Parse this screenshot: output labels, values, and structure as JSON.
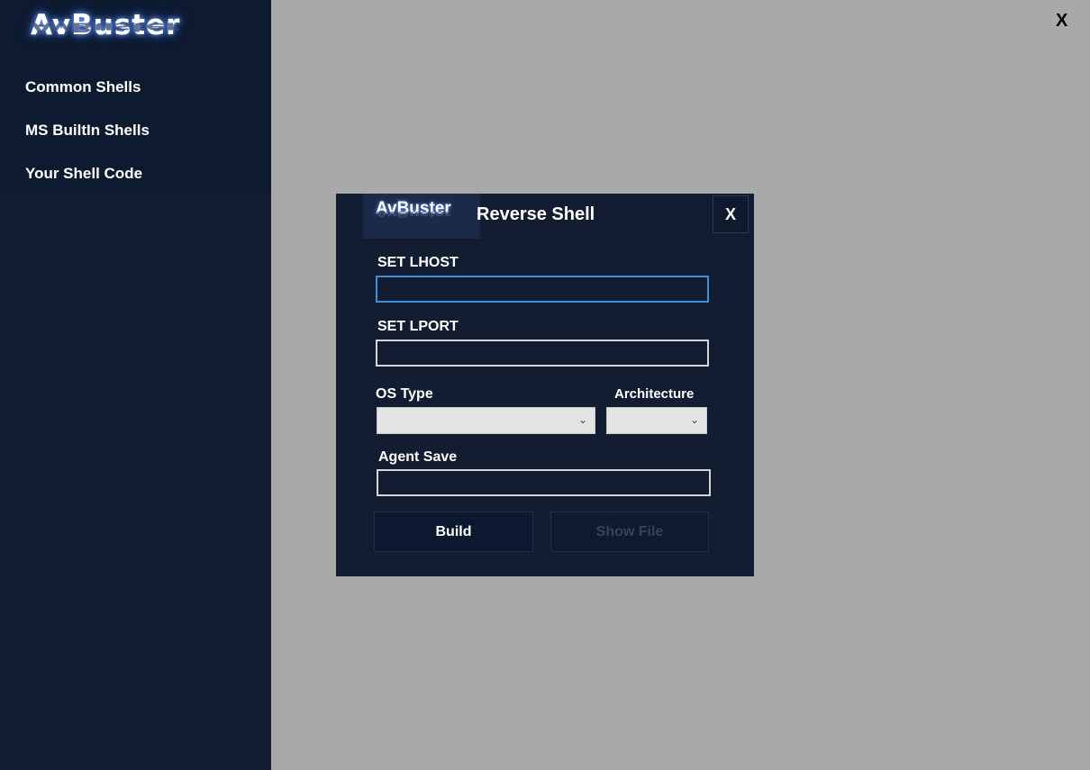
{
  "app": {
    "logo": "AvBuster",
    "close_label": "X"
  },
  "sidebar": {
    "items": [
      {
        "label": "Common Shells"
      },
      {
        "label": "MS BuiltIn Shells"
      },
      {
        "label": "Your Shell Code"
      }
    ]
  },
  "dialog": {
    "logo": "AvBuster",
    "title": "Reverse Shell",
    "close_label": "X",
    "lhost_label": "SET LHOST",
    "lhost_value": "",
    "lport_label": "SET LPORT",
    "lport_value": "",
    "os_type_label": "OS Type",
    "os_type_value": "",
    "architecture_label": "Architecture",
    "architecture_value": "",
    "agent_save_label": "Agent Save",
    "agent_save_value": "",
    "build_label": "Build",
    "show_file_label": "Show File"
  },
  "colors": {
    "sidebar_bg": "#121d31",
    "main_bg": "#a9a9a9",
    "focus_border": "#3f8fd8"
  }
}
